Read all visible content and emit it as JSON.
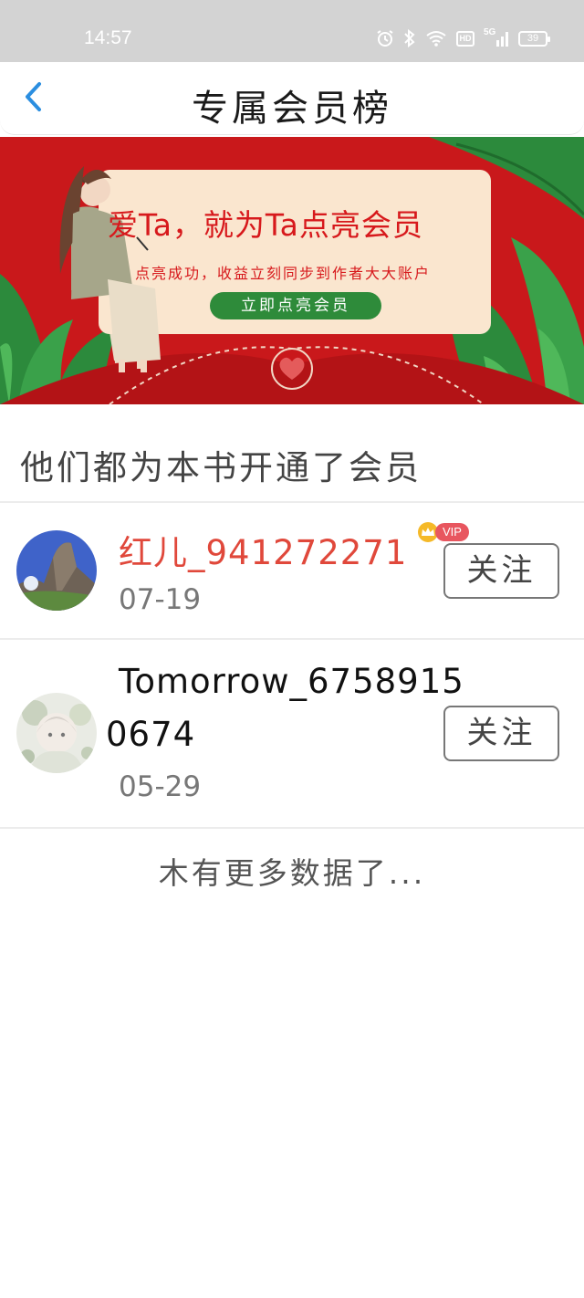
{
  "status_bar": {
    "time": "14:57",
    "icons": [
      "alarm-icon",
      "bluetooth-icon",
      "wifi-icon",
      "hd-icon",
      "signal-5g-icon",
      "battery-icon"
    ],
    "hd_label": "HD",
    "network_label": "5G",
    "battery_level": "39"
  },
  "nav": {
    "back_icon": "chevron-left-icon",
    "title": "专属会员榜"
  },
  "banner": {
    "headline": "爱Ta，就为Ta点亮会员",
    "subtitle": "点亮成功，收益立刻同步到作者大大账户",
    "button_label": "立即点亮会员",
    "colors": {
      "background": "#c9181b",
      "card": "#fae6cf",
      "button": "#2e8b3a"
    }
  },
  "section": {
    "title": "他们都为本书开通了会员"
  },
  "members": [
    {
      "name": "红儿_941272271",
      "date": "07-19",
      "vip": true,
      "vip_label": "VIP",
      "name_color": "#e0483b",
      "follow_label": "关注"
    },
    {
      "name_line1": "Tomorrow_6758915",
      "name_line2": "0674",
      "date": "05-29",
      "vip": false,
      "name_color": "#111111",
      "follow_label": "关注"
    }
  ],
  "footer": {
    "text": "木有更多数据了..."
  }
}
